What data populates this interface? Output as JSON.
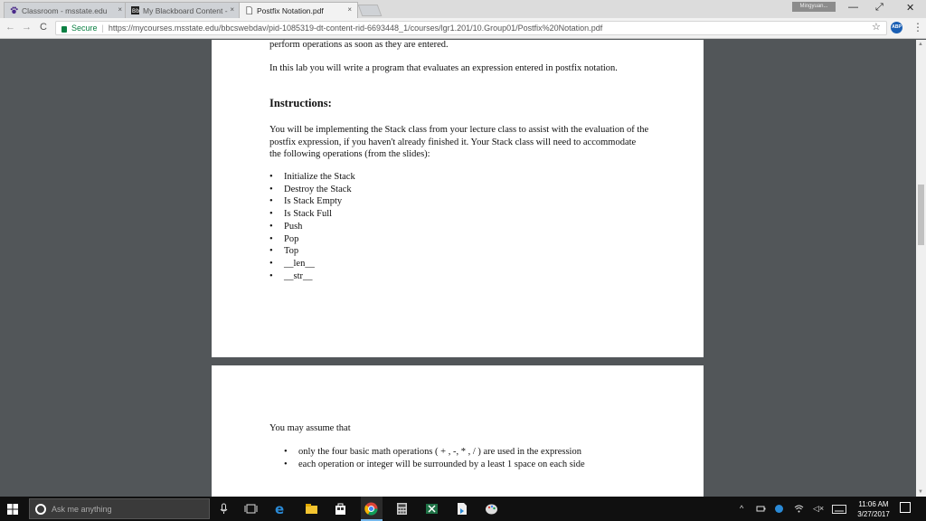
{
  "browser": {
    "tabs": [
      {
        "title": "Classroom - msstate.edu",
        "active": false
      },
      {
        "title": "My Blackboard Content -",
        "active": false
      },
      {
        "title": "Postfix Notation.pdf",
        "active": true
      }
    ],
    "tab_close": "×",
    "user_badge": "Mingyuan...",
    "window_controls": {
      "minimize": "—",
      "maximize": "⤢",
      "close": "✕"
    },
    "nav": {
      "back": "←",
      "forward": "→",
      "reload": "C"
    },
    "address": {
      "secure_label": "Secure",
      "url": "https://mycourses.msstate.edu/bbcswebdav/pid-1085319-dt-content-rid-6693448_1/courses/lgr1.201/10.Group01/Postfix%20Notation.pdf"
    },
    "bookmark_icon": "☆",
    "extension_label": "ABP",
    "menu_icon": "⋮"
  },
  "document": {
    "page1": {
      "top_line": "perform operations as soon as they are entered.",
      "intro": "In this lab you will write a program that evaluates an expression entered in postfix notation.",
      "heading": "Instructions:",
      "paragraph": "You will be implementing the Stack class from your lecture class to assist with the evaluation of the postfix expression, if you haven't already finished it.  Your Stack class will need to accommodate the following operations (from the slides):",
      "operations": [
        "Initialize the Stack",
        "Destroy the Stack",
        "Is Stack Empty",
        "Is Stack Full",
        "Push",
        "Pop",
        "Top",
        "__len__",
        "__str__"
      ]
    },
    "page2": {
      "intro": "You may assume that",
      "assumptions": [
        "only the four basic math operations ( + , -, * , / ) are used in the expression",
        "each operation or integer will be surrounded by a least 1 space on each side"
      ]
    }
  },
  "taskbar": {
    "search_placeholder": "Ask me anything",
    "tray": {
      "up_arrow": "^",
      "volume": "◁×"
    },
    "clock": {
      "time": "11:06 AM",
      "date": "3/27/2017"
    }
  },
  "colors": {
    "secure_green": "#0b8043",
    "taskbar": "#101010",
    "pdf_background": "#525659"
  }
}
